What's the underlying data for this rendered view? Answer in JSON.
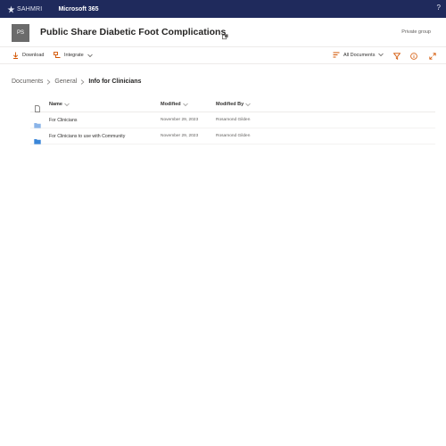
{
  "suite": {
    "logo_text": "SAHMRI",
    "app_name": "Microsoft 365",
    "help_glyph": "?"
  },
  "site": {
    "badge": "PS",
    "title": "Public Share Diabetic Foot Complications",
    "privacy": "Private group"
  },
  "commands": {
    "download": "Download",
    "integrate": "Integrate",
    "view": "All Documents"
  },
  "breadcrumb": {
    "items": [
      "Documents",
      "General"
    ],
    "current": "Info for Clinicians"
  },
  "table": {
    "columns": {
      "name": "Name",
      "modified": "Modified",
      "modified_by": "Modified By"
    },
    "rows": [
      {
        "name": "For Clinicians",
        "modified": "November 29, 2023",
        "modified_by": "Rosamond Gilden",
        "icon": "folder-icon",
        "color": "#8ab4e8"
      },
      {
        "name": "For Clinicians to use with Community",
        "modified": "November 29, 2023",
        "modified_by": "Rosamond Gilden",
        "icon": "shared-folder-icon",
        "color": "#3a86d8"
      }
    ]
  },
  "colors": {
    "suite_bar": "#1f2a5c",
    "accent": "#d35400"
  }
}
